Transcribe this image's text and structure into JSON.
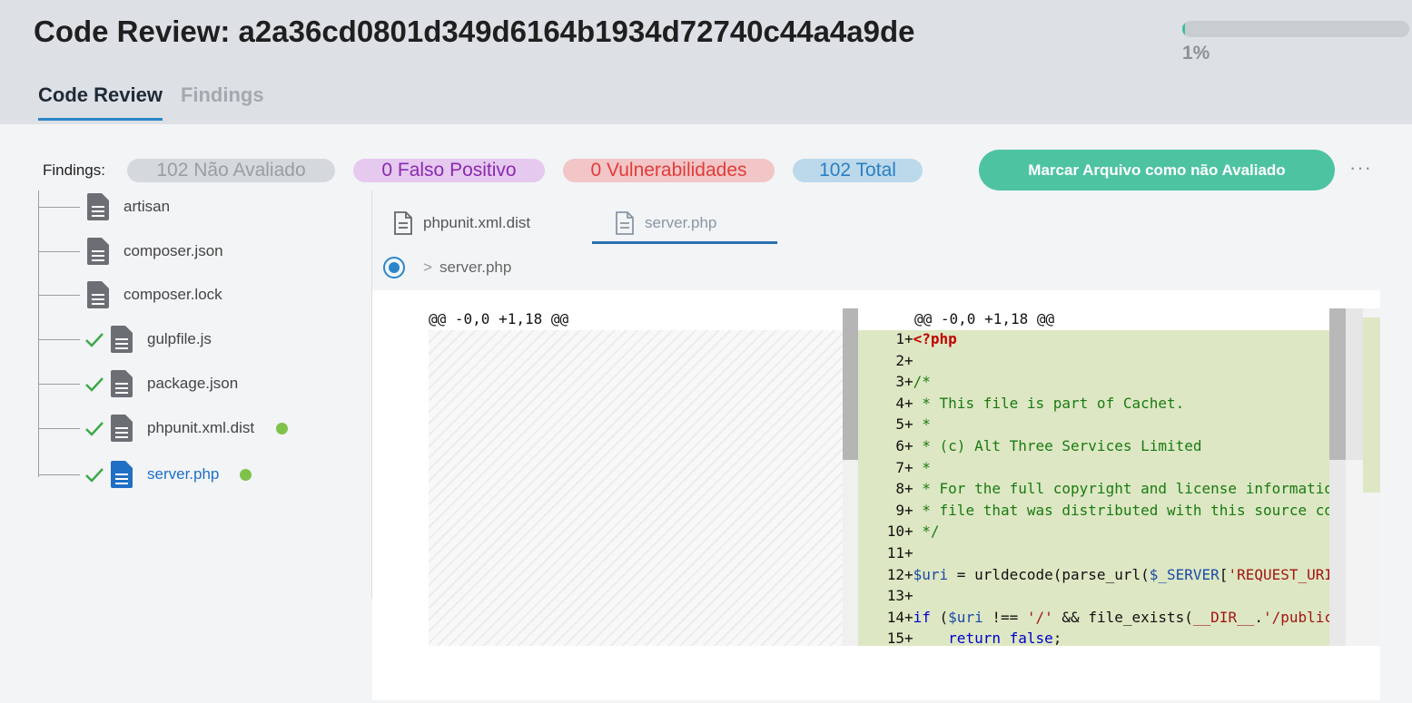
{
  "header": {
    "title": "Code Review: a2a36cd0801d349d6164b1934d72740c44a4a9de",
    "progress_label": "1%",
    "progress_value": 0.01,
    "tabs": [
      {
        "label": "Code Review",
        "active": true
      },
      {
        "label": "Findings",
        "active": false
      }
    ]
  },
  "findings": {
    "label": "Findings:",
    "not_evaluated": "102 Não Avaliado",
    "false_positive": "0 Falso Positivo",
    "vulnerabilities": "0 Vulnerabilidades",
    "total": "102 Total",
    "mark_button": "Marcar Arquivo como não Avaliado",
    "more": "···"
  },
  "tree": {
    "items": [
      {
        "label": "artisan",
        "checked": false,
        "dot": false,
        "active": false
      },
      {
        "label": "composer.json",
        "checked": false,
        "dot": false,
        "active": false
      },
      {
        "label": "composer.lock",
        "checked": false,
        "dot": false,
        "active": false
      },
      {
        "label": "gulpfile.js",
        "checked": true,
        "dot": false,
        "active": false
      },
      {
        "label": "package.json",
        "checked": true,
        "dot": false,
        "active": false
      },
      {
        "label": "phpunit.xml.dist",
        "checked": true,
        "dot": true,
        "active": false
      },
      {
        "label": "server.php",
        "checked": true,
        "dot": true,
        "active": true
      }
    ]
  },
  "editor": {
    "tabs": [
      {
        "label": "phpunit.xml.dist",
        "active": false
      },
      {
        "label": "server.php",
        "active": true
      }
    ],
    "breadcrumb": "server.php",
    "breadcrumb_chevron": ">",
    "hunk_left": "@@ -0,0 +1,18 @@",
    "hunk_right": "@@ -0,0 +1,18 @@",
    "lines": [
      {
        "n": "1",
        "text": "<?php"
      },
      {
        "n": "2",
        "text": ""
      },
      {
        "n": "3",
        "text": "/*"
      },
      {
        "n": "4",
        "text": " * This file is part of Cachet."
      },
      {
        "n": "5",
        "text": " *"
      },
      {
        "n": "6",
        "text": " * (c) Alt Three Services Limited"
      },
      {
        "n": "7",
        "text": " *"
      },
      {
        "n": "8",
        "text": " * For the full copyright and license informatio"
      },
      {
        "n": "9",
        "text": " * file that was distributed with this source co"
      },
      {
        "n": "10",
        "text": " */"
      },
      {
        "n": "11",
        "text": ""
      },
      {
        "n": "12",
        "text": "$uri = urldecode(parse_url($_SERVER['REQUEST_URI"
      },
      {
        "n": "13",
        "text": ""
      },
      {
        "n": "14",
        "text": "if ($uri !== '/' && file_exists(__DIR__.'/public"
      },
      {
        "n": "15",
        "text": "    return false;"
      }
    ]
  },
  "colors": {
    "accent": "#2a86c9",
    "button": "#4ec3a2",
    "added_bg": "#dde7c3",
    "check": "#3aa845",
    "dot": "#7ec24a"
  }
}
